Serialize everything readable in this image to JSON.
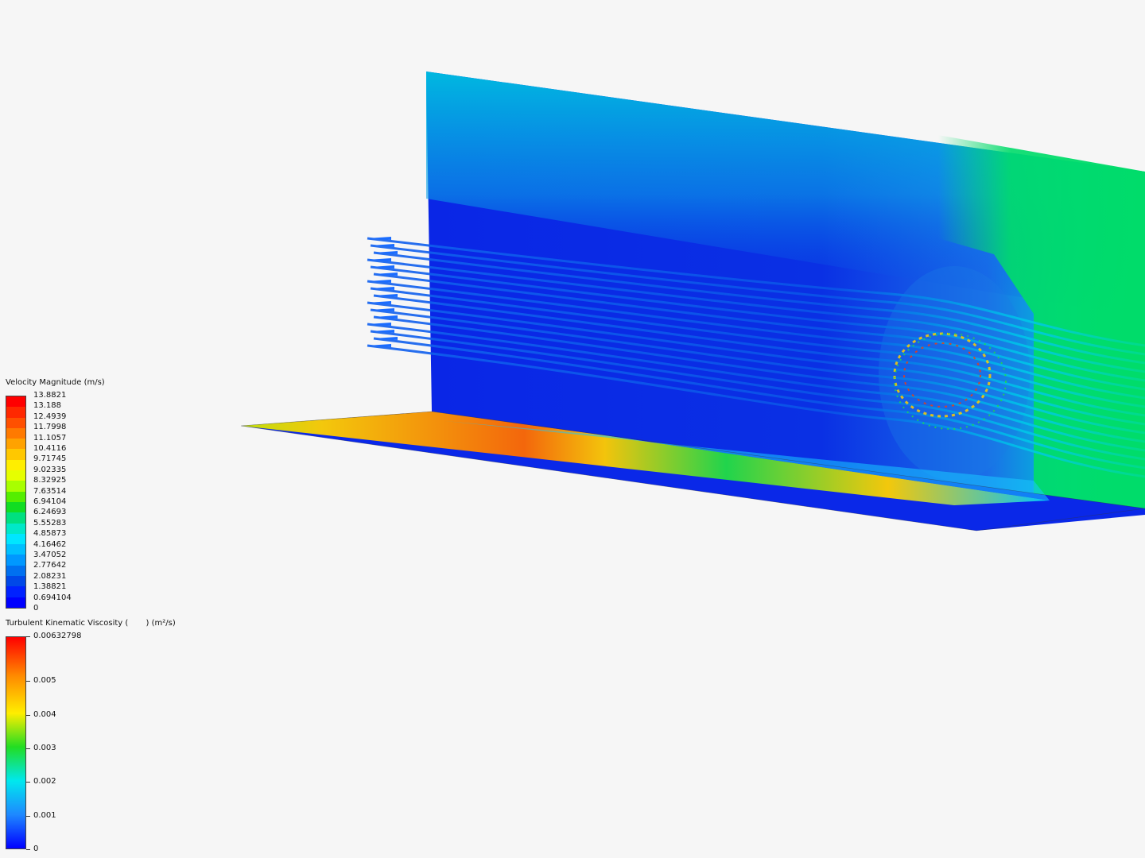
{
  "velocity_legend": {
    "title": "Velocity Magnitude (m/s)",
    "colors": [
      "#ff0000",
      "#ff2800",
      "#ff5000",
      "#ff7a00",
      "#ffa200",
      "#ffc800",
      "#ffee00",
      "#e6ff00",
      "#a8ff00",
      "#55ee00",
      "#11dd22",
      "#00e080",
      "#00e8c8",
      "#00e6ff",
      "#00c0ff",
      "#0098ff",
      "#0070f0",
      "#0048e8",
      "#0022ff",
      "#0000ff"
    ],
    "ticks": [
      "13.8821",
      "13.188",
      "12.4939",
      "11.7998",
      "11.1057",
      "10.4116",
      "9.71745",
      "9.02335",
      "8.32925",
      "7.63514",
      "6.94104",
      "6.24693",
      "5.55283",
      "4.85873",
      "4.16462",
      "3.47052",
      "2.77642",
      "2.08231",
      "1.38821",
      "0.694104",
      "0"
    ],
    "range": [
      0,
      13.8821
    ]
  },
  "tkv_legend": {
    "title": "Turbulent Kinematic Viscosity (       ) (m²/s)",
    "ticks": [
      {
        "label": "0.00632798",
        "value": 0.00632798
      },
      {
        "label": "0.005",
        "value": 0.005
      },
      {
        "label": "0.004",
        "value": 0.004
      },
      {
        "label": "0.003",
        "value": 0.003
      },
      {
        "label": "0.002",
        "value": 0.002
      },
      {
        "label": "0.001",
        "value": 0.001
      },
      {
        "label": "0",
        "value": 0
      }
    ],
    "range": [
      0,
      0.00632798
    ]
  },
  "colors": {
    "background": "#f6f6f6",
    "slow": "#0a22e8",
    "mid": "#00d6e6",
    "fast": "#00dc6a",
    "hot": "#ff7a00"
  }
}
